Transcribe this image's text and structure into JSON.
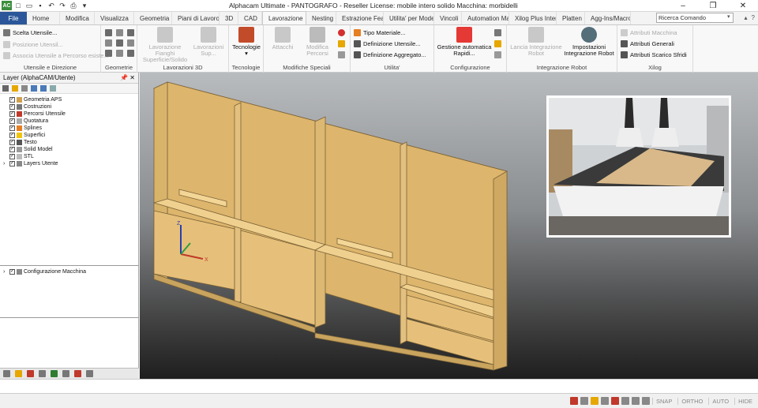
{
  "window": {
    "title": "Alphacam Ultimate - PANTOGRAFO - Reseller License: mobile intero solido Macchina: morbidelli",
    "app_icon": "AC"
  },
  "tabs": [
    "File",
    "Home",
    "Modifica",
    "Visualizza",
    "Geometria",
    "Piani di Lavoro",
    "3D",
    "CAD",
    "Lavorazione",
    "Nesting",
    "Estrazione Featu",
    "Utilita' per Mode",
    "Vincoli",
    "Automation Mar",
    "Xilog Plus Interfa",
    "Platten",
    "Agg-Ins/Macro"
  ],
  "active_tab": "Lavorazione",
  "search": {
    "placeholder": "Ricerca Comando"
  },
  "ribbon": {
    "g1": {
      "label": "Utensile e Direzione",
      "items": [
        "Scelta Utensile...",
        "Posizione Utensil...",
        "Associa Utensile a Percorso esiste..."
      ]
    },
    "g2": {
      "label": "Geometrie"
    },
    "g3": {
      "label": "Lavorazioni 3D",
      "b1": "Lavorazione Fianghi Superficie/Solido",
      "b2": "Lavorazioni Sup..."
    },
    "g4": {
      "label": "Tecnologie",
      "b1": "Tecnologie"
    },
    "g5": {
      "label": "Modifiche Speciali",
      "b1": "Attacchi",
      "b2": "Modifica Percorsi"
    },
    "g6": {
      "label": "Utilita'",
      "items": [
        "Tipo Materiale...",
        "Definizione Utensile...",
        "Definizione Aggregato..."
      ]
    },
    "g7": {
      "label": "Configurazione",
      "b1": "Gestione automatica Rapidi..."
    },
    "g8": {
      "label": "Integrazione Robot",
      "b1": "Lancia Integrazione Robot",
      "b2": "Impostazioni Integrazione Robot"
    },
    "g9": {
      "label": "Xilog",
      "items": [
        "Attributi Macchina",
        "Attributi Generali",
        "Attributi Scarico Sfridi"
      ]
    }
  },
  "layers_panel": {
    "title": "Layer (AlphaCAM/Utente)",
    "items": [
      "Geometria APS",
      "Costruzioni",
      "Percorsi Utensile",
      "Quotatura",
      "Splines",
      "Superfici",
      "Testo",
      "Solid Model",
      "STL",
      "Layers Utente"
    ],
    "config": "Configurazione Macchina"
  },
  "statusbar": {
    "snap": "SNAP",
    "ortho": "ORTHO",
    "auto": "AUTO",
    "hide": "HIDE"
  },
  "colors": {
    "file_tab": "#2b579a",
    "furniture": "#e8c27a",
    "viewport_top": "#b9bcbf",
    "viewport_bottom": "#1e1e1e"
  }
}
